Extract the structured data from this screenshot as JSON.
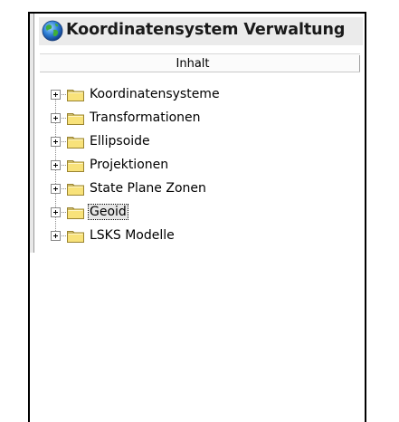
{
  "window": {
    "title": "Koordinatensystem Verwaltung",
    "icon": "globe-icon"
  },
  "header": {
    "column_label": "Inhalt"
  },
  "tree": {
    "items": [
      {
        "label": "Koordinatensysteme",
        "icon": "folder-icon",
        "expanded": false,
        "selected": false
      },
      {
        "label": "Transformationen",
        "icon": "folder-icon",
        "expanded": false,
        "selected": false
      },
      {
        "label": "Ellipsoide",
        "icon": "folder-icon",
        "expanded": false,
        "selected": false
      },
      {
        "label": "Projektionen",
        "icon": "folder-icon",
        "expanded": false,
        "selected": false
      },
      {
        "label": "State Plane Zonen",
        "icon": "folder-icon",
        "expanded": false,
        "selected": false
      },
      {
        "label": "Geoid",
        "icon": "folder-icon",
        "expanded": false,
        "selected": true
      },
      {
        "label": "LSKS Modelle",
        "icon": "folder-icon",
        "expanded": false,
        "selected": false
      }
    ]
  },
  "colors": {
    "folder_fill": "#f8e27a",
    "folder_stroke": "#9a8430",
    "selection_bg": "#e6e6e6"
  }
}
